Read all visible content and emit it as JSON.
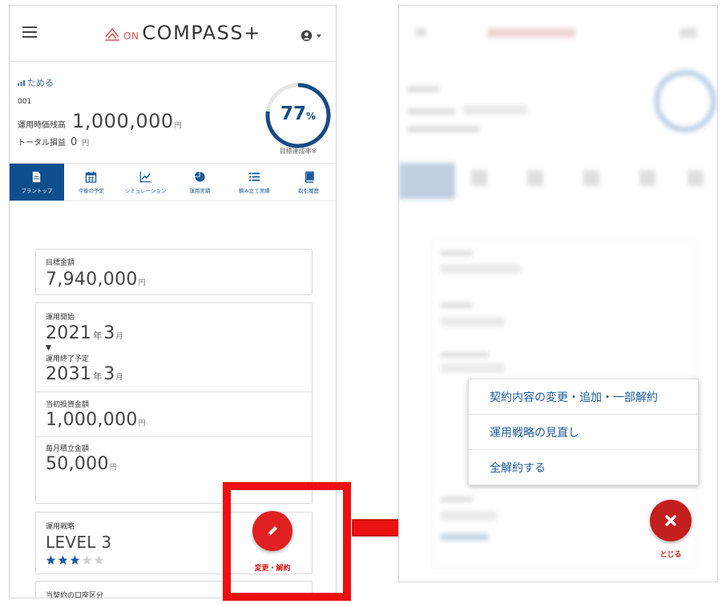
{
  "header": {
    "logo_on": "ON",
    "logo_main": "COMPASS+",
    "brand_color": "#d65a55",
    "menu_icon": "hamburger-icon",
    "user_icon": "user-circle-icon"
  },
  "summary": {
    "goal_name": "ためる",
    "account_no": "001",
    "balance_label": "運用時価残高",
    "balance_value": "1,000,000",
    "balance_unit": "円",
    "profit_label": "トータル損益",
    "profit_value": "0",
    "profit_unit": "円",
    "progress_percent": "77",
    "progress_percent_sign": "%",
    "progress_fraction": 0.77,
    "progress_label": "目標達成率※",
    "ring_color": "#174b86"
  },
  "tabs": [
    {
      "label": "プラントップ",
      "icon": "document-icon",
      "active": true
    },
    {
      "label": "今後の予定",
      "icon": "calendar-icon",
      "active": false
    },
    {
      "label": "シミュレーション",
      "icon": "line-chart-icon",
      "active": false
    },
    {
      "label": "運用実績",
      "icon": "pie-chart-icon",
      "active": false
    },
    {
      "label": "積み立て実績",
      "icon": "list-icon",
      "active": false
    },
    {
      "label": "取引履歴",
      "icon": "book-icon",
      "active": false
    }
  ],
  "plan": {
    "target_amount_label": "目標金額",
    "target_amount_value": "7,940,000",
    "target_amount_unit": "円",
    "start_label": "運用開始",
    "start_year": "2021",
    "start_year_unit": "年",
    "start_month": "3",
    "start_month_unit": "月",
    "arrow": "▼",
    "end_label": "運用終了予定",
    "end_year": "2031",
    "end_year_unit": "年",
    "end_month": "3",
    "end_month_unit": "月",
    "initial_label": "当初投資金額",
    "initial_value": "1,000,000",
    "initial_unit": "円",
    "monthly_label": "毎月積立金額",
    "monthly_value": "50,000",
    "monthly_unit": "円",
    "strategy_label": "運用戦略",
    "strategy_value": "LEVEL 3",
    "strategy_stars_filled": 3,
    "strategy_stars_total": 5,
    "account_type_label": "当契約の口座区分"
  },
  "fab": {
    "icon": "pencil-icon",
    "label": "変更・解約",
    "color": "#e02020"
  },
  "popup_menu": {
    "items": [
      "契約内容の変更・追加・一部解約",
      "運用戦略の見直し",
      "全解約する"
    ]
  },
  "close_fab": {
    "icon": "close-icon",
    "label": "とじる",
    "color": "#c41f1f"
  },
  "highlight_color": "#ed1010"
}
